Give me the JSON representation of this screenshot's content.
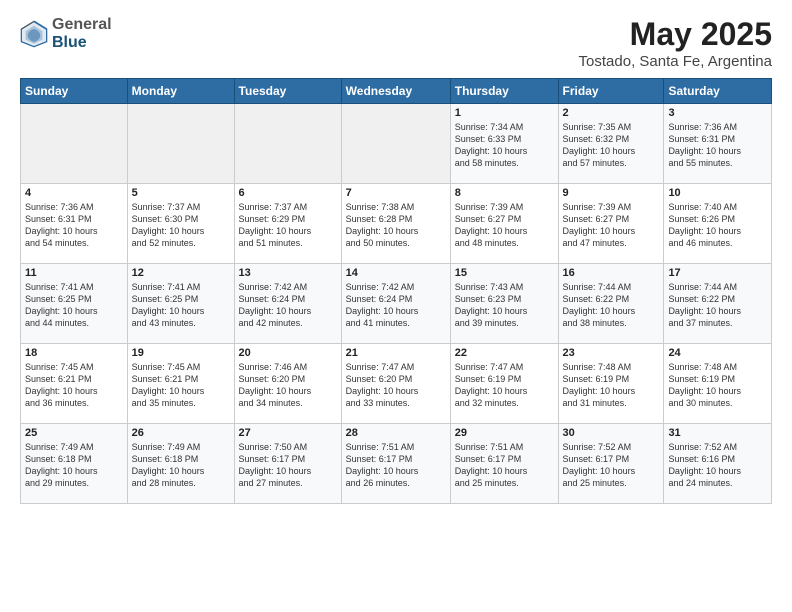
{
  "header": {
    "logo_general": "General",
    "logo_blue": "Blue",
    "title": "May 2025",
    "subtitle": "Tostado, Santa Fe, Argentina"
  },
  "weekdays": [
    "Sunday",
    "Monday",
    "Tuesday",
    "Wednesday",
    "Thursday",
    "Friday",
    "Saturday"
  ],
  "weeks": [
    [
      {
        "day": "",
        "info": ""
      },
      {
        "day": "",
        "info": ""
      },
      {
        "day": "",
        "info": ""
      },
      {
        "day": "",
        "info": ""
      },
      {
        "day": "1",
        "info": "Sunrise: 7:34 AM\nSunset: 6:33 PM\nDaylight: 10 hours\nand 58 minutes."
      },
      {
        "day": "2",
        "info": "Sunrise: 7:35 AM\nSunset: 6:32 PM\nDaylight: 10 hours\nand 57 minutes."
      },
      {
        "day": "3",
        "info": "Sunrise: 7:36 AM\nSunset: 6:31 PM\nDaylight: 10 hours\nand 55 minutes."
      }
    ],
    [
      {
        "day": "4",
        "info": "Sunrise: 7:36 AM\nSunset: 6:31 PM\nDaylight: 10 hours\nand 54 minutes."
      },
      {
        "day": "5",
        "info": "Sunrise: 7:37 AM\nSunset: 6:30 PM\nDaylight: 10 hours\nand 52 minutes."
      },
      {
        "day": "6",
        "info": "Sunrise: 7:37 AM\nSunset: 6:29 PM\nDaylight: 10 hours\nand 51 minutes."
      },
      {
        "day": "7",
        "info": "Sunrise: 7:38 AM\nSunset: 6:28 PM\nDaylight: 10 hours\nand 50 minutes."
      },
      {
        "day": "8",
        "info": "Sunrise: 7:39 AM\nSunset: 6:27 PM\nDaylight: 10 hours\nand 48 minutes."
      },
      {
        "day": "9",
        "info": "Sunrise: 7:39 AM\nSunset: 6:27 PM\nDaylight: 10 hours\nand 47 minutes."
      },
      {
        "day": "10",
        "info": "Sunrise: 7:40 AM\nSunset: 6:26 PM\nDaylight: 10 hours\nand 46 minutes."
      }
    ],
    [
      {
        "day": "11",
        "info": "Sunrise: 7:41 AM\nSunset: 6:25 PM\nDaylight: 10 hours\nand 44 minutes."
      },
      {
        "day": "12",
        "info": "Sunrise: 7:41 AM\nSunset: 6:25 PM\nDaylight: 10 hours\nand 43 minutes."
      },
      {
        "day": "13",
        "info": "Sunrise: 7:42 AM\nSunset: 6:24 PM\nDaylight: 10 hours\nand 42 minutes."
      },
      {
        "day": "14",
        "info": "Sunrise: 7:42 AM\nSunset: 6:24 PM\nDaylight: 10 hours\nand 41 minutes."
      },
      {
        "day": "15",
        "info": "Sunrise: 7:43 AM\nSunset: 6:23 PM\nDaylight: 10 hours\nand 39 minutes."
      },
      {
        "day": "16",
        "info": "Sunrise: 7:44 AM\nSunset: 6:22 PM\nDaylight: 10 hours\nand 38 minutes."
      },
      {
        "day": "17",
        "info": "Sunrise: 7:44 AM\nSunset: 6:22 PM\nDaylight: 10 hours\nand 37 minutes."
      }
    ],
    [
      {
        "day": "18",
        "info": "Sunrise: 7:45 AM\nSunset: 6:21 PM\nDaylight: 10 hours\nand 36 minutes."
      },
      {
        "day": "19",
        "info": "Sunrise: 7:45 AM\nSunset: 6:21 PM\nDaylight: 10 hours\nand 35 minutes."
      },
      {
        "day": "20",
        "info": "Sunrise: 7:46 AM\nSunset: 6:20 PM\nDaylight: 10 hours\nand 34 minutes."
      },
      {
        "day": "21",
        "info": "Sunrise: 7:47 AM\nSunset: 6:20 PM\nDaylight: 10 hours\nand 33 minutes."
      },
      {
        "day": "22",
        "info": "Sunrise: 7:47 AM\nSunset: 6:19 PM\nDaylight: 10 hours\nand 32 minutes."
      },
      {
        "day": "23",
        "info": "Sunrise: 7:48 AM\nSunset: 6:19 PM\nDaylight: 10 hours\nand 31 minutes."
      },
      {
        "day": "24",
        "info": "Sunrise: 7:48 AM\nSunset: 6:19 PM\nDaylight: 10 hours\nand 30 minutes."
      }
    ],
    [
      {
        "day": "25",
        "info": "Sunrise: 7:49 AM\nSunset: 6:18 PM\nDaylight: 10 hours\nand 29 minutes."
      },
      {
        "day": "26",
        "info": "Sunrise: 7:49 AM\nSunset: 6:18 PM\nDaylight: 10 hours\nand 28 minutes."
      },
      {
        "day": "27",
        "info": "Sunrise: 7:50 AM\nSunset: 6:17 PM\nDaylight: 10 hours\nand 27 minutes."
      },
      {
        "day": "28",
        "info": "Sunrise: 7:51 AM\nSunset: 6:17 PM\nDaylight: 10 hours\nand 26 minutes."
      },
      {
        "day": "29",
        "info": "Sunrise: 7:51 AM\nSunset: 6:17 PM\nDaylight: 10 hours\nand 25 minutes."
      },
      {
        "day": "30",
        "info": "Sunrise: 7:52 AM\nSunset: 6:17 PM\nDaylight: 10 hours\nand 25 minutes."
      },
      {
        "day": "31",
        "info": "Sunrise: 7:52 AM\nSunset: 6:16 PM\nDaylight: 10 hours\nand 24 minutes."
      }
    ]
  ]
}
